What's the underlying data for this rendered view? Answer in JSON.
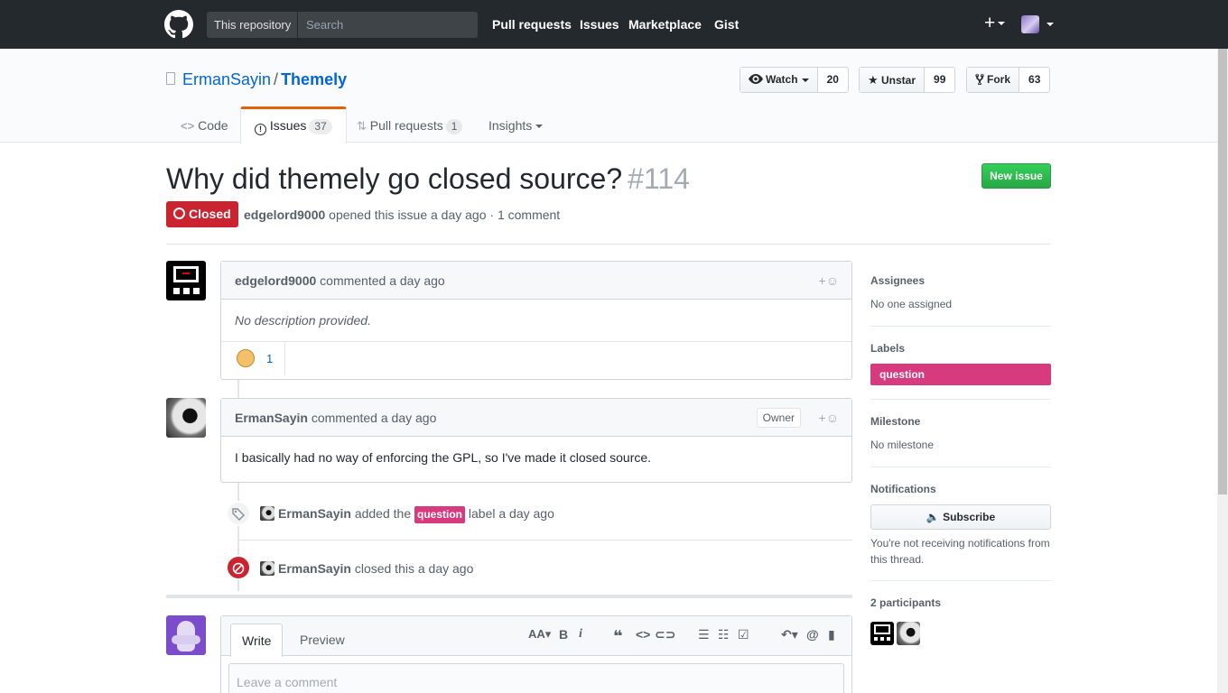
{
  "header": {
    "search_scope": "This repository",
    "search_placeholder": "Search",
    "nav": [
      "Pull requests",
      "Issues",
      "Marketplace",
      "Gist"
    ],
    "plus": "+"
  },
  "repo": {
    "owner": "ErmanSayin",
    "separator": "/",
    "name": "Themely",
    "watch": {
      "label": "Watch",
      "count": "20"
    },
    "star": {
      "label": "Unstar",
      "count": "99"
    },
    "fork": {
      "label": "Fork",
      "count": "63"
    },
    "tabs": {
      "code": "Code",
      "issues": "Issues",
      "issues_count": "37",
      "pulls": "Pull requests",
      "pulls_count": "1",
      "insights": "Insights"
    }
  },
  "issue": {
    "title": "Why did themely go closed source?",
    "number": "#114",
    "new_issue": "New issue",
    "state": "Closed",
    "author": "edgelord9000",
    "meta_text": "opened this issue a day ago · 1 comment"
  },
  "comments": [
    {
      "author": "edgelord9000",
      "action": "commented a day ago",
      "body": "No description provided.",
      "reaction_count": "1"
    },
    {
      "author": "ErmanSayin",
      "action": "commented a day ago",
      "badge": "Owner",
      "body": "I basically had no way of enforcing the GPL, so I've made it closed source."
    }
  ],
  "events": [
    {
      "actor": "ErmanSayin",
      "pre": "added the",
      "label": "question",
      "post": "label a day ago"
    },
    {
      "actor": "ErmanSayin",
      "text": "closed this a day ago"
    }
  ],
  "form": {
    "write": "Write",
    "preview": "Preview",
    "placeholder": "Leave a comment"
  },
  "sidebar": {
    "assignees": {
      "title": "Assignees",
      "value": "No one assigned"
    },
    "labels": {
      "title": "Labels",
      "value": "question"
    },
    "milestone": {
      "title": "Milestone",
      "value": "No milestone"
    },
    "notifications": {
      "title": "Notifications",
      "button": "Subscribe",
      "reason": "You're not receiving notifications from this thread."
    },
    "participants": {
      "title": "2 participants"
    }
  },
  "colors": {
    "closed": "#cb2431",
    "label_question": "#d73a7d",
    "new_issue_green": "#28a745",
    "tab_accent": "#e36209"
  }
}
